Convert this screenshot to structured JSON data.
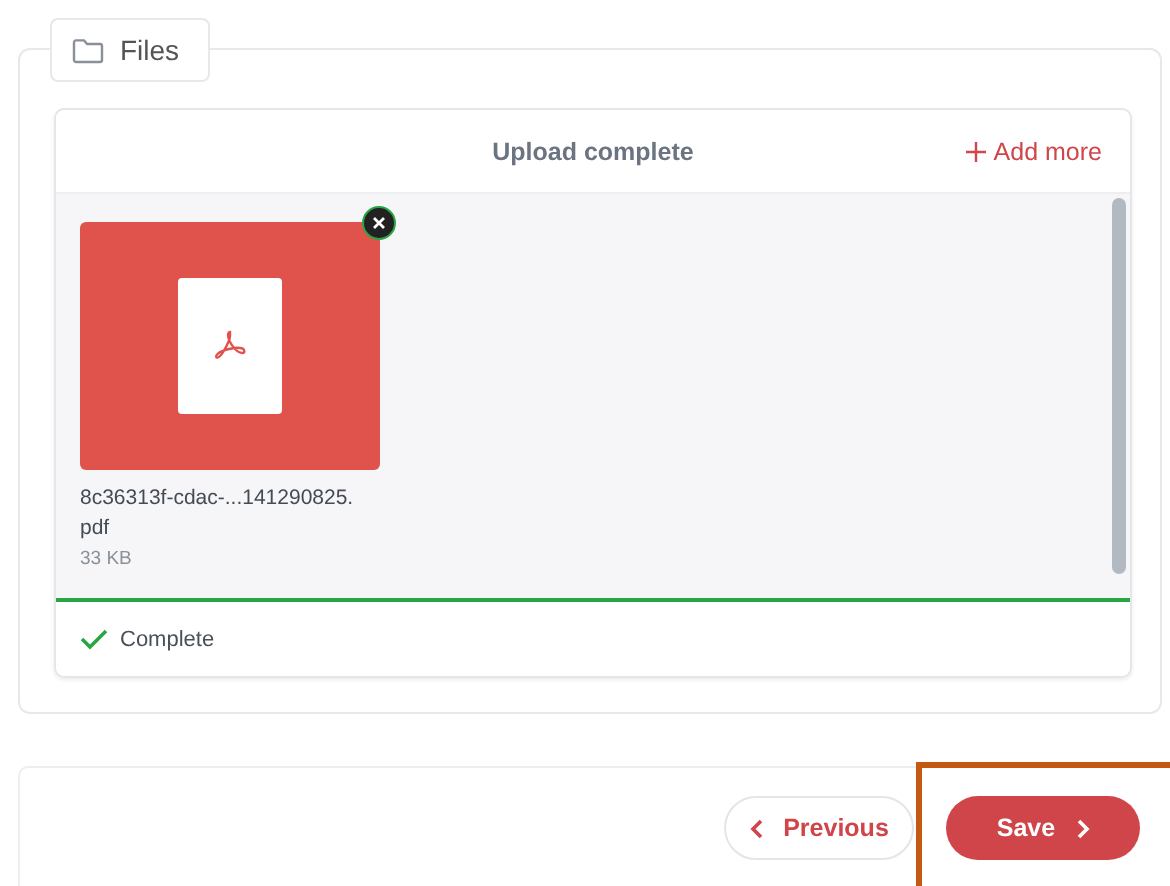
{
  "files_section": {
    "legend": "Files",
    "uploader": {
      "status": "Upload complete",
      "add_more": "Add more",
      "files": [
        {
          "name": "8c36313f-cdac-...141290825.",
          "extension": "pdf",
          "size": "33 KB"
        }
      ],
      "footer_status": "Complete"
    }
  },
  "actions": [
    {
      "kind": "previous",
      "label": "Previous",
      "highlighted": false
    },
    {
      "kind": "next",
      "label": "Save",
      "highlighted": true
    }
  ]
}
